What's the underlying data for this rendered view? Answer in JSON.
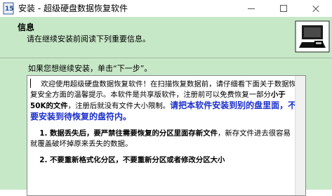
{
  "window": {
    "title": "安装 - 超级硬盘数据恢复软件"
  },
  "header": {
    "title": "信息",
    "subtitle": "请在继续安装前阅读下列重要信息。"
  },
  "prompt": "如果您想继续安装，单击“下一步”。",
  "license": {
    "intro_a": "欢迎使用超级硬盘数据恢复软件！在扫描恢复数据前，请仔细看下面关于数据恢复安全方面的温馨提示。本软件是共享版软件，注册前可以免费恢复一部分",
    "intro_bold": "小于50K的文件",
    "intro_b": "，注册后就没有文件大小限制。",
    "warning": "请把本软件安装到别的盘里面，不要安装到待恢复的盘符内。",
    "item1_bold": "1. 数据丢失后，要严禁往需要恢复的分区里面存新文件",
    "item1_rest": "，新存文件进去很容易就覆盖破坏掉原来丢失的数据。",
    "item2_partial": "2. 不要重新格式化分区，不要重新分区或者修改分区大小"
  },
  "colors": {
    "panel": "#c7e8c7",
    "warning_text": "#1b2fcc"
  }
}
